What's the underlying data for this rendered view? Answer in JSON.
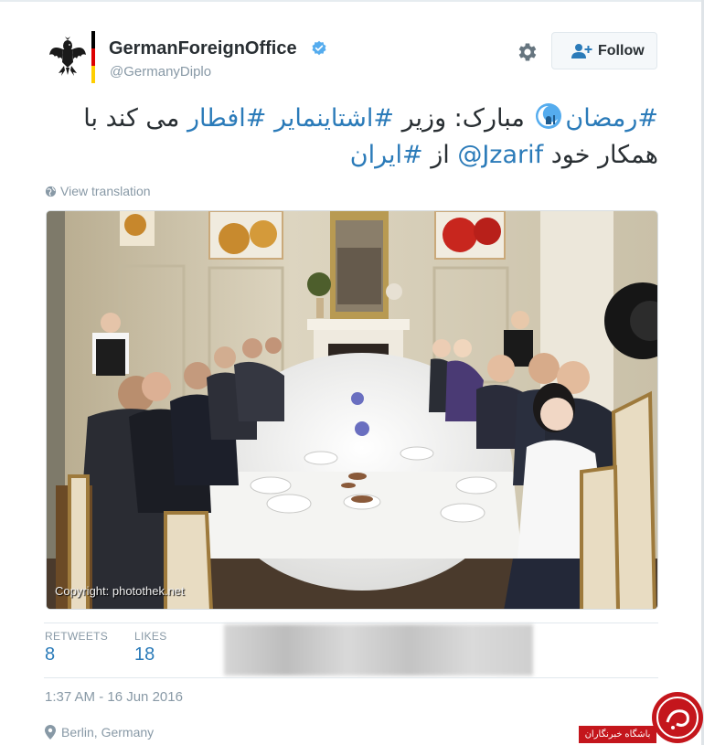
{
  "tweet": {
    "display_name": "GermanForeignOffice",
    "handle": "@GermanyDiplo",
    "follow_label": "Follow",
    "text_line1": {
      "hashtag_ramadan": "#رمضان",
      "ramadan_emoji": "crescent-moon-mosque-emoji",
      "plain1": " مبارک: وزیر ",
      "hashtag_steinmeier": "#اشتاینمایر",
      "plain2": " ",
      "hashtag_iftar": "#افطار",
      "plain3": " می کند با"
    },
    "text_line2": {
      "plain1": "همکار خود ",
      "mention": "@Jzarif",
      "plain2": " از ",
      "hashtag_iran": "#ایران"
    },
    "view_translation": "View translation",
    "photo_copyright": "Copyright: photothek.net",
    "retweets_label": "RETWEETS",
    "retweets_count": "8",
    "likes_label": "LIKES",
    "likes_count": "18",
    "timestamp": "1:37 AM - 16 Jun 2016",
    "location": "Berlin, Germany"
  },
  "watermark": {
    "badge_text": "باشگاه خبرنگاران"
  },
  "icons": {
    "avatar": "german-eagle-flag-logo",
    "verified": "verified-badge-icon",
    "settings": "gear-icon",
    "follow": "add-user-icon",
    "translation": "globe-icon",
    "location": "map-pin-icon"
  },
  "colors": {
    "link": "#2b7bb9",
    "muted": "#8899a6",
    "text": "#292f33",
    "verified": "#55acee",
    "watermark_red": "#c4161c"
  }
}
